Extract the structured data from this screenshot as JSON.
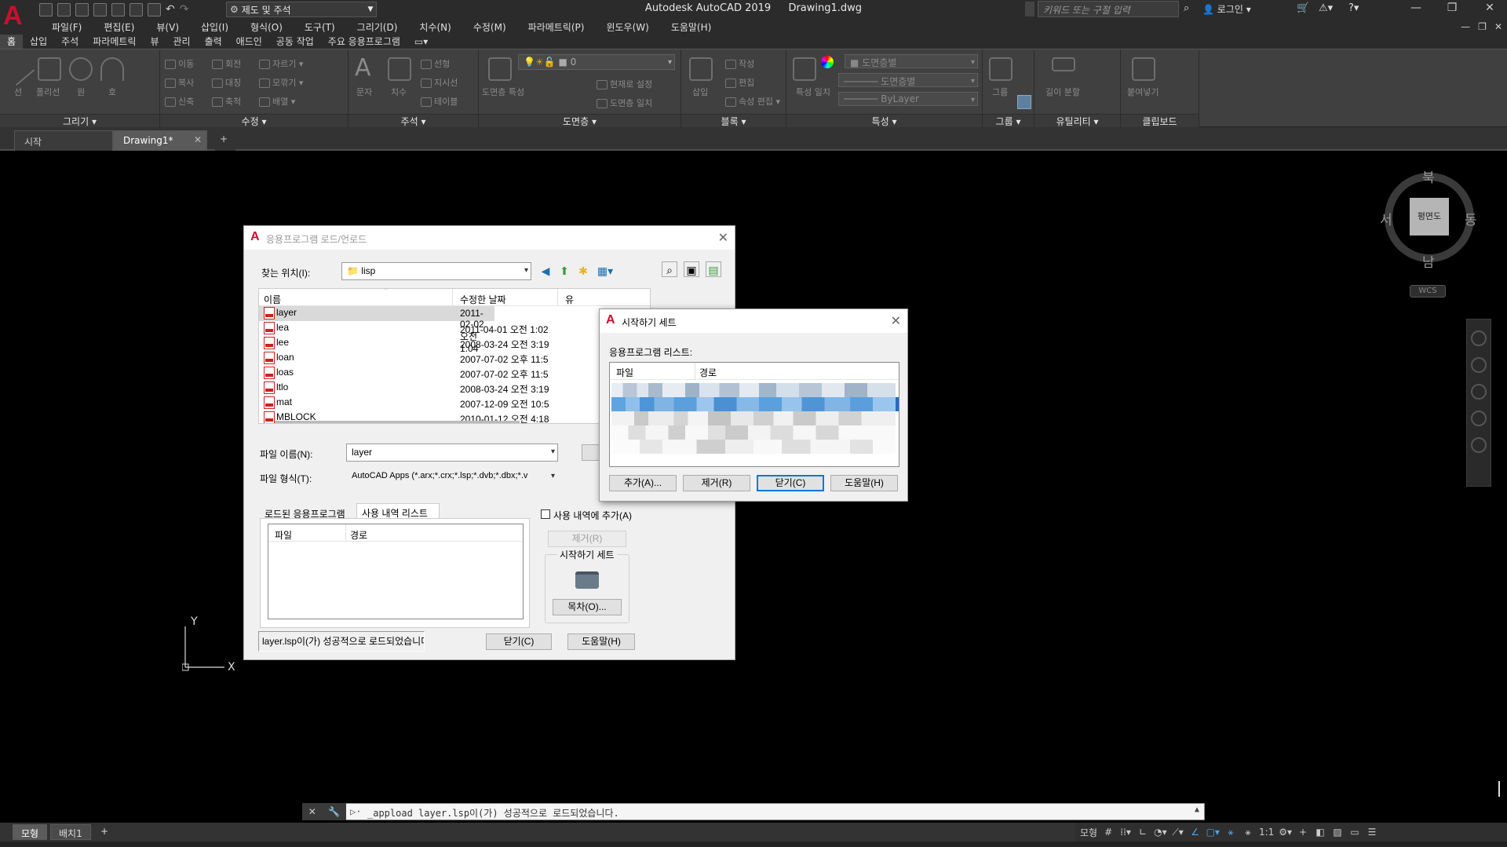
{
  "app": {
    "title": "Autodesk AutoCAD 2019",
    "drawing": "Drawing1.dwg",
    "logo_letter": "A",
    "workspace": "제도 및 주석",
    "search_placeholder": "키워드 또는 구절 입력",
    "login": "로그인"
  },
  "menubar": [
    "파일(F)",
    "편집(E)",
    "뷰(V)",
    "삽입(I)",
    "형식(O)",
    "도구(T)",
    "그리기(D)",
    "치수(N)",
    "수정(M)",
    "파라메트릭(P)",
    "윈도우(W)",
    "도움말(H)"
  ],
  "ribbon_tabs": [
    "홈",
    "삽입",
    "주석",
    "파라메트릭",
    "뷰",
    "관리",
    "출력",
    "애드인",
    "공동 작업",
    "주요 응용프로그램"
  ],
  "ribbon_panels": {
    "draw": {
      "title": "그리기",
      "tools": [
        "선",
        "폴리선",
        "원",
        "호"
      ]
    },
    "modify": {
      "title": "수정",
      "tools": [
        "이동",
        "회전",
        "자르기",
        "복사",
        "대칭",
        "모깎기",
        "신축",
        "축척",
        "배열"
      ]
    },
    "annotation": {
      "title": "주석",
      "tools": [
        "문자",
        "치수",
        "선형",
        "지시선",
        "테이블"
      ]
    },
    "layers": {
      "title": "도면층",
      "tools": [
        "도면층 특성",
        "현재로 설정",
        "도면층 일치"
      ],
      "current_layer": "0"
    },
    "block": {
      "title": "블록",
      "tools": [
        "삽입",
        "작성",
        "편집",
        "속성 편집"
      ]
    },
    "properties": {
      "title": "특성",
      "tools": [
        "특성 일치"
      ],
      "color": "도면층별",
      "linetype": "도면층별",
      "lineweight": "ByLayer"
    },
    "groups": {
      "title": "그룹",
      "tools": [
        "그룹"
      ]
    },
    "utilities": {
      "title": "유틸리티",
      "tools": [
        "길이 분할"
      ]
    },
    "clipboard": {
      "title": "클립보드",
      "tools": [
        "붙여넣기"
      ]
    }
  },
  "file_tabs": [
    {
      "label": "시작"
    },
    {
      "label": "Drawing1*"
    }
  ],
  "viewcube": {
    "north": "북",
    "south": "남",
    "east": "동",
    "west": "서",
    "face": "평면도",
    "wcs": "WCS"
  },
  "ucs": {
    "y": "Y",
    "x": "X"
  },
  "appload_dialog": {
    "title": "응용프로그램 로드/언로드",
    "look_in_label": "찾는 위치(I):",
    "look_in_value": "lisp",
    "columns": [
      "이름",
      "수정한 날짜",
      "유"
    ],
    "files": [
      {
        "name": "layer",
        "date": "2011-02-02 오전 1:04"
      },
      {
        "name": "lea",
        "date": "2011-04-01 오전 1:02"
      },
      {
        "name": "lee",
        "date": "2008-03-24 오전 3:19"
      },
      {
        "name": "loan",
        "date": "2007-07-02 오후 11:5"
      },
      {
        "name": "loas",
        "date": "2007-07-02 오후 11:5"
      },
      {
        "name": "ltlo",
        "date": "2008-03-24 오전 3:19"
      },
      {
        "name": "mat",
        "date": "2007-12-09 오전 10:5"
      },
      {
        "name": "MBLOCK",
        "date": "2010-01-12 오전 4:18"
      }
    ],
    "filename_label": "파일 이름(N):",
    "filename_value": "layer",
    "filetype_label": "파일 형식(T):",
    "filetype_value": "AutoCAD Apps (*.arx;*.crx;*.lsp;*.dvb;*.dbx;*.v",
    "tab_loaded": "로드된 응용프로그램",
    "tab_history": "사용 내역 리스트",
    "history_columns": [
      "파일",
      "경로"
    ],
    "add_history_label": "사용 내역에 추가(A)",
    "remove_label": "제거(R)",
    "startup_group": "시작하기 세트",
    "contents_label": "목차(O)...",
    "status_text": "layer.lsp이(가) 성공적으로 로드되었습니다.",
    "close_label": "닫기(C)",
    "help_label": "도움말(H)"
  },
  "startup_dialog": {
    "title": "시작하기 세트",
    "list_label": "응용프로그램 리스트:",
    "columns": [
      "파일",
      "경로"
    ],
    "add_label": "추가(A)...",
    "remove_label": "제거(R)",
    "close_label": "닫기(C)",
    "help_label": "도움말(H)"
  },
  "command_line": {
    "text": "_appload layer.lsp이(가) 성공적으로 로드되었습니다."
  },
  "layout_tabs": [
    "모형",
    "배치1"
  ],
  "status": {
    "model": "모형",
    "scale": "1:1"
  }
}
